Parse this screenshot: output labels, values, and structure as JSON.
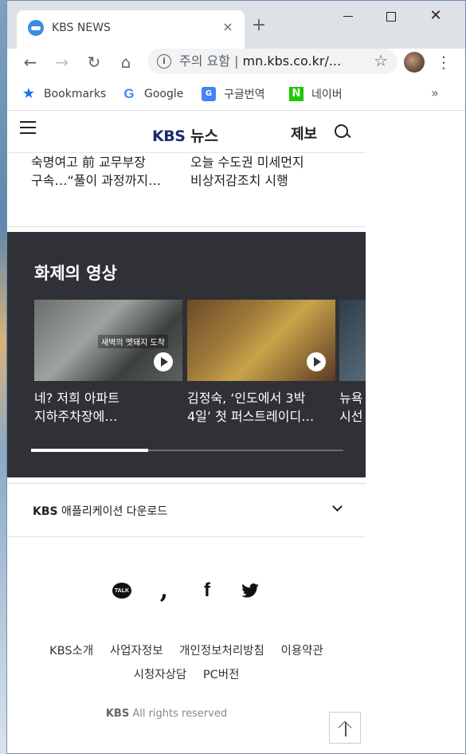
{
  "browser": {
    "tab_title": "KBS NEWS",
    "close_tab_glyph": "×",
    "new_tab_glyph": "+",
    "omnibox_security": "주의 요함",
    "omnibox_url": "mn.kbs.co.kr/...",
    "window_close_glyph": "✕"
  },
  "bookmarks": {
    "items": [
      {
        "label": "Bookmarks",
        "icon": "star-icon"
      },
      {
        "label": "Google",
        "icon": "google-icon"
      },
      {
        "label": "구글번역",
        "icon": "translate-icon"
      },
      {
        "label": "네이버",
        "icon": "naver-icon"
      }
    ],
    "more": "»"
  },
  "site": {
    "logo_kbs": "KBS",
    "logo_news": "뉴스",
    "report": "제보"
  },
  "news": [
    {
      "line1": "숙명여고 前 교무부장",
      "line2": "구속…“풀이 과정까지…"
    },
    {
      "line1": "오늘 수도권 미세먼지",
      "line2": "비상저감조치 시행"
    }
  ],
  "videos": {
    "heading": "화제의 영상",
    "items": [
      {
        "line1": "네? 저희 아파트",
        "line2": "지하주차장에…",
        "caption": "새벽의 멧돼지 도착"
      },
      {
        "line1": "김정숙, ‘인도에서 3박",
        "line2": "4일’ 첫 퍼스트레이디…"
      },
      {
        "line1": "뉴욕",
        "line2": "시선"
      }
    ],
    "progress_fraction": 0.375
  },
  "app_download": {
    "brand": "KBS",
    "label": " 애플리케이션 다운로드"
  },
  "social": [
    "kakaotalk-icon",
    "kakaostory-icon",
    "facebook-icon",
    "twitter-icon"
  ],
  "social_labels": {
    "talk": "TALK",
    "story": ",",
    "facebook": "f",
    "twitter": "🐦"
  },
  "footer": {
    "links_row1": [
      "KBS소개",
      "사업자정보",
      "개인정보처리방침",
      "이용약관"
    ],
    "links_row2": [
      "시청자상담",
      "PC버전"
    ],
    "copyright_brand": "KBS",
    "copyright_text": " All rights reserved"
  }
}
